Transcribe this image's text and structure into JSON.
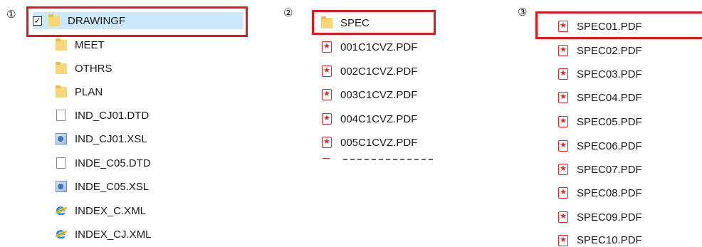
{
  "markers": {
    "m1": "①",
    "m2": "②",
    "m3": "③"
  },
  "pane1": {
    "items": [
      {
        "label": "DRAWINGF",
        "icon": "folder-icon",
        "selected": true,
        "checked": true
      },
      {
        "label": "MEET",
        "icon": "folder-icon"
      },
      {
        "label": "OTHRS",
        "icon": "folder-icon"
      },
      {
        "label": "PLAN",
        "icon": "folder-icon"
      },
      {
        "label": "IND_CJ01.DTD",
        "icon": "document-icon"
      },
      {
        "label": "IND_CJ01.XSL",
        "icon": "xsl-file-icon"
      },
      {
        "label": "INDE_C05.DTD",
        "icon": "document-icon"
      },
      {
        "label": "INDE_C05.XSL",
        "icon": "xsl-file-icon"
      },
      {
        "label": "INDEX_C.XML",
        "icon": "internet-explorer-icon"
      },
      {
        "label": "INDEX_CJ.XML",
        "icon": "internet-explorer-icon"
      }
    ]
  },
  "pane2": {
    "items": [
      {
        "label": "SPEC",
        "icon": "folder-icon"
      },
      {
        "label": "001C1CVZ.PDF",
        "icon": "pdf-icon"
      },
      {
        "label": "002C1CVZ.PDF",
        "icon": "pdf-icon"
      },
      {
        "label": "003C1CVZ.PDF",
        "icon": "pdf-icon"
      },
      {
        "label": "004C1CVZ.PDF",
        "icon": "pdf-icon"
      },
      {
        "label": "005C1CVZ.PDF",
        "icon": "pdf-icon"
      }
    ]
  },
  "pane3": {
    "items": [
      {
        "label": "SPEC01.PDF",
        "icon": "pdf-icon"
      },
      {
        "label": "SPEC02.PDF",
        "icon": "pdf-icon"
      },
      {
        "label": "SPEC03.PDF",
        "icon": "pdf-icon"
      },
      {
        "label": "SPEC04.PDF",
        "icon": "pdf-icon"
      },
      {
        "label": "SPEC05.PDF",
        "icon": "pdf-icon"
      },
      {
        "label": "SPEC06.PDF",
        "icon": "pdf-icon"
      },
      {
        "label": "SPEC07.PDF",
        "icon": "pdf-icon"
      },
      {
        "label": "SPEC08.PDF",
        "icon": "pdf-icon"
      },
      {
        "label": "SPEC09.PDF",
        "icon": "pdf-icon"
      },
      {
        "label": "SPEC10.PDF",
        "icon": "pdf-icon"
      }
    ]
  }
}
